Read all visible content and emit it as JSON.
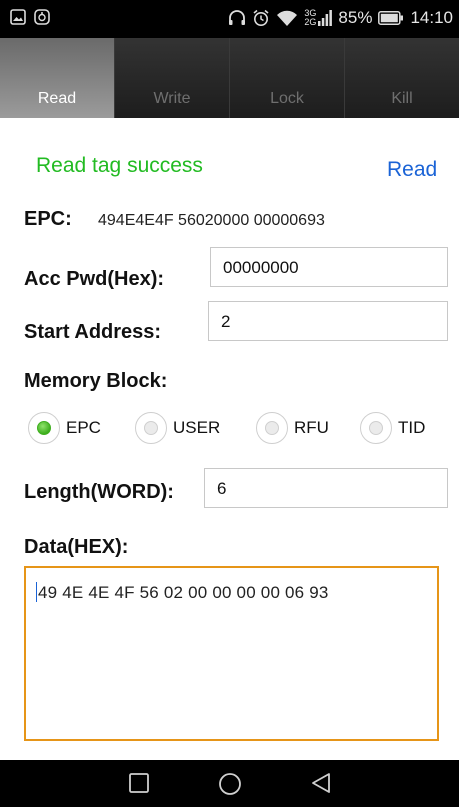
{
  "status_bar": {
    "battery_percent": "85%",
    "time": "14:10",
    "network_top": "3G",
    "network_bottom": "2G"
  },
  "tabs": [
    {
      "label": "Read",
      "active": true
    },
    {
      "label": "Write",
      "active": false
    },
    {
      "label": "Lock",
      "active": false
    },
    {
      "label": "Kill",
      "active": false
    }
  ],
  "header": {
    "status_message": "Read tag success",
    "read_button": "Read"
  },
  "epc": {
    "label": "EPC:",
    "value": "494E4E4F 56020000 00000693"
  },
  "acc_pwd": {
    "label": "Acc Pwd(Hex):",
    "value": "00000000"
  },
  "start_address": {
    "label": "Start Address:",
    "value": "2"
  },
  "memory_block": {
    "label": "Memory Block:",
    "options": [
      "EPC",
      "USER",
      "RFU",
      "TID"
    ],
    "selected": "EPC"
  },
  "length": {
    "label": "Length(WORD):",
    "value": "6"
  },
  "data": {
    "label": "Data(HEX):",
    "value": "49 4E 4E 4F 56 02 00 00 00 00 06 93"
  },
  "colors": {
    "success": "#22bb22",
    "link": "#1a63d6",
    "focus_border": "#e69518",
    "radio_selected": "#3faf1f"
  }
}
